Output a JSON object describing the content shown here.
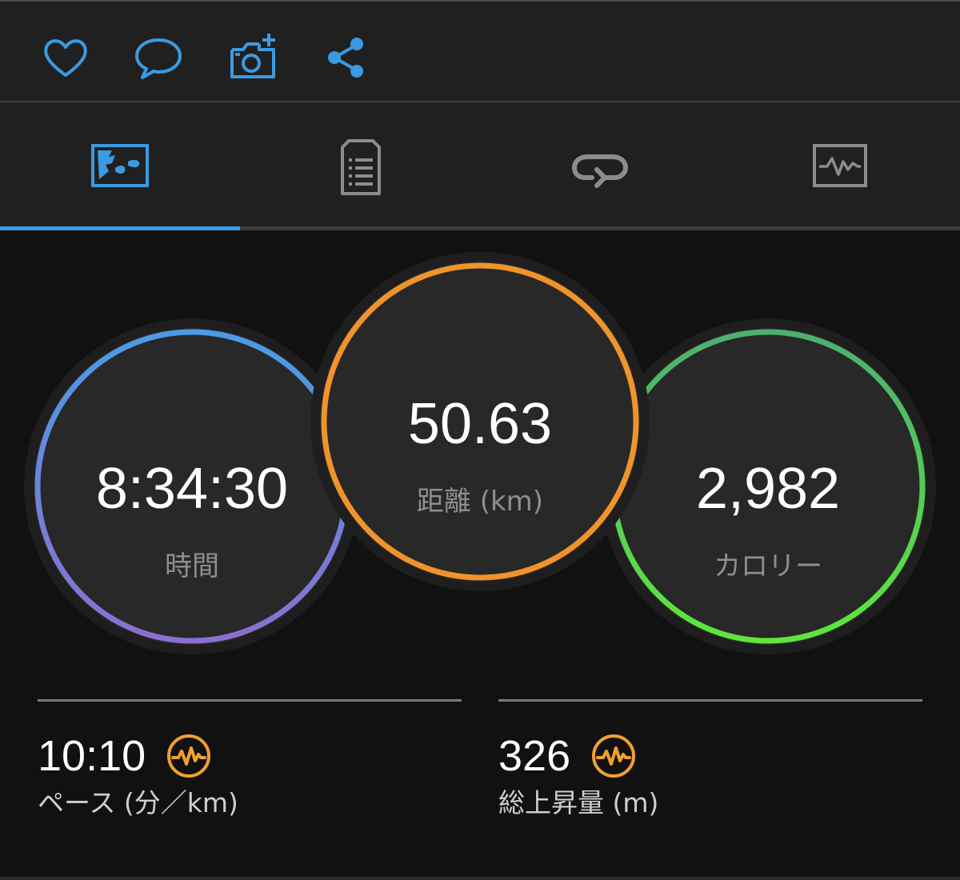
{
  "theme": {
    "accent": "#3b9ae1",
    "background": "#111111",
    "bar_background": "#202020",
    "metric_icon_color": "#f0a030"
  },
  "action_bar": {
    "icons": [
      "heart-icon",
      "comment-icon",
      "add-photo-icon",
      "share-icon"
    ]
  },
  "tabs": [
    {
      "icon": "map-overview-icon",
      "selected": true
    },
    {
      "icon": "details-list-icon",
      "selected": false
    },
    {
      "icon": "laps-icon",
      "selected": false
    },
    {
      "icon": "chart-icon",
      "selected": false
    }
  ],
  "stats": {
    "time": {
      "value": "8:34:30",
      "label": "時間",
      "ring_colors": [
        "#4a9be6",
        "#8a6fd0"
      ]
    },
    "distance": {
      "value": "50.63",
      "label": "距離 (km)",
      "ring_color": "#f0932b"
    },
    "calories": {
      "value": "2,982",
      "label": "カロリー",
      "ring_colors": [
        "#4cb070",
        "#5ee63c"
      ]
    }
  },
  "metrics": {
    "pace": {
      "value": "10:10",
      "label": "ペース (分／km)",
      "icon": "activity-pulse-icon"
    },
    "ascent": {
      "value": "326",
      "label": "総上昇量 (m)",
      "icon": "activity-pulse-icon"
    }
  }
}
